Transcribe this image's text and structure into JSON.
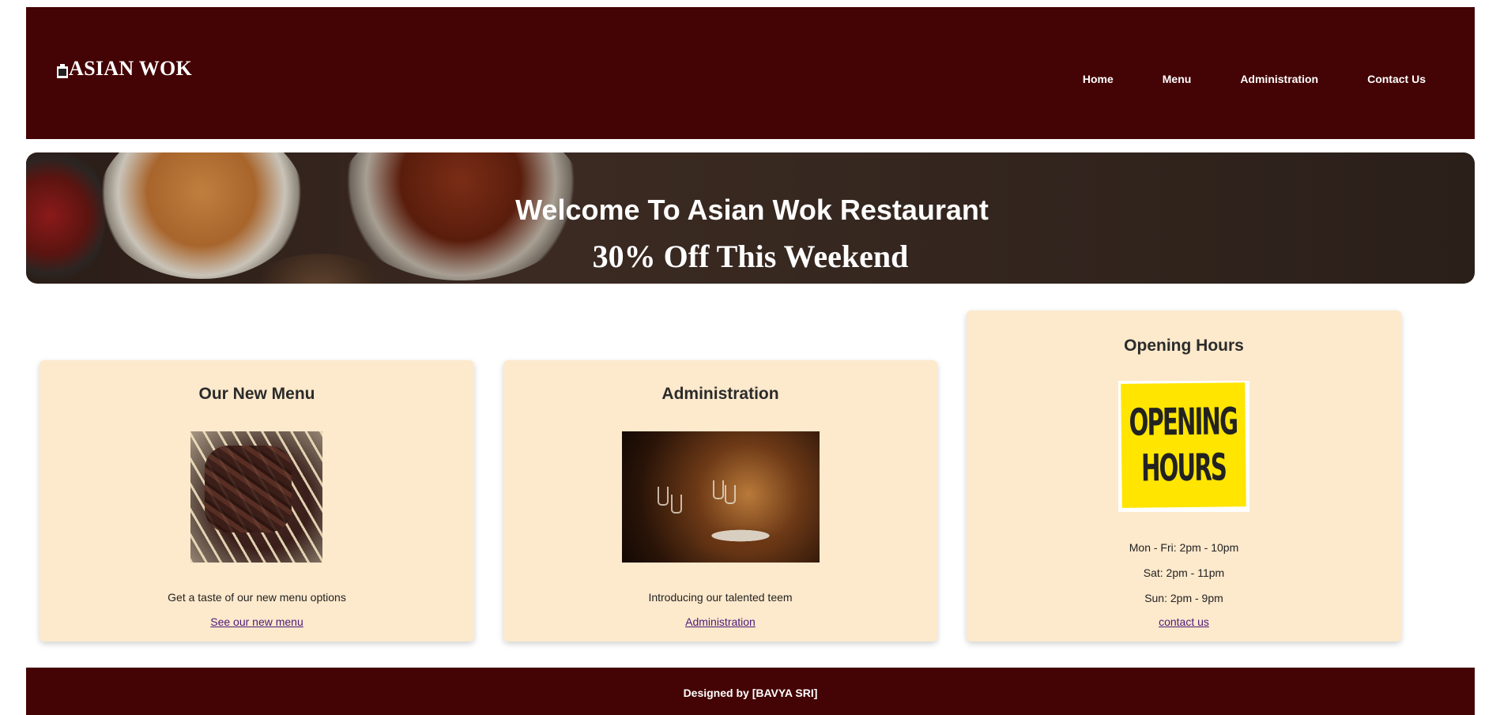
{
  "header": {
    "logo_text": "ASIAN WOK",
    "nav": [
      {
        "label": "Home"
      },
      {
        "label": "Menu"
      },
      {
        "label": "Administration"
      },
      {
        "label": "Contact Us"
      }
    ]
  },
  "hero": {
    "title": "Welcome To Asian Wok Restaurant",
    "subtitle": "30% Off This Weekend"
  },
  "cards": {
    "menu": {
      "title": "Our New Menu",
      "description": "Get a taste of our new menu options",
      "link": "See our new menu"
    },
    "administration": {
      "title": "Administration",
      "description": "Introducing our talented teem",
      "link": "Administration"
    },
    "hours": {
      "title": "Opening Hours",
      "sign_line1": "OPENING",
      "sign_line2": "HOURS",
      "lines": [
        "Mon - Fri: 2pm - 10pm",
        "Sat: 2pm - 11pm",
        "Sun: 2pm - 9pm"
      ],
      "link": "contact us"
    }
  },
  "footer": {
    "text": "Designed by [BAVYA SRI]"
  },
  "colors": {
    "header_bg": "#440304",
    "card_bg": "#fde9cc",
    "link": "#4b1a7a"
  }
}
